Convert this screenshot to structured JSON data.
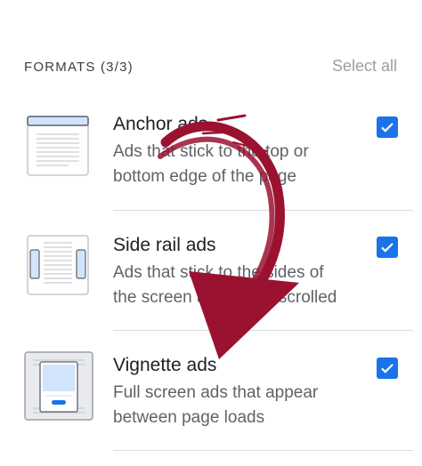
{
  "header": {
    "title": "FORMATS (3/3)",
    "select_all": "Select all"
  },
  "formats": [
    {
      "title": "Anchor ads",
      "desc_line1": "Ads that stick to the top or",
      "desc_line2": "bottom edge of the page",
      "checked": true
    },
    {
      "title": "Side rail ads",
      "desc_line1": "Ads that stick to the sides of",
      "desc_line2": "the screen as page is scrolled",
      "checked": true
    },
    {
      "title": "Vignette ads",
      "desc_line1": "Full screen ads that appear",
      "desc_line2": "between page loads",
      "checked": true
    }
  ],
  "colors": {
    "accent": "#1a73e8",
    "arrow": "#9b1231"
  }
}
